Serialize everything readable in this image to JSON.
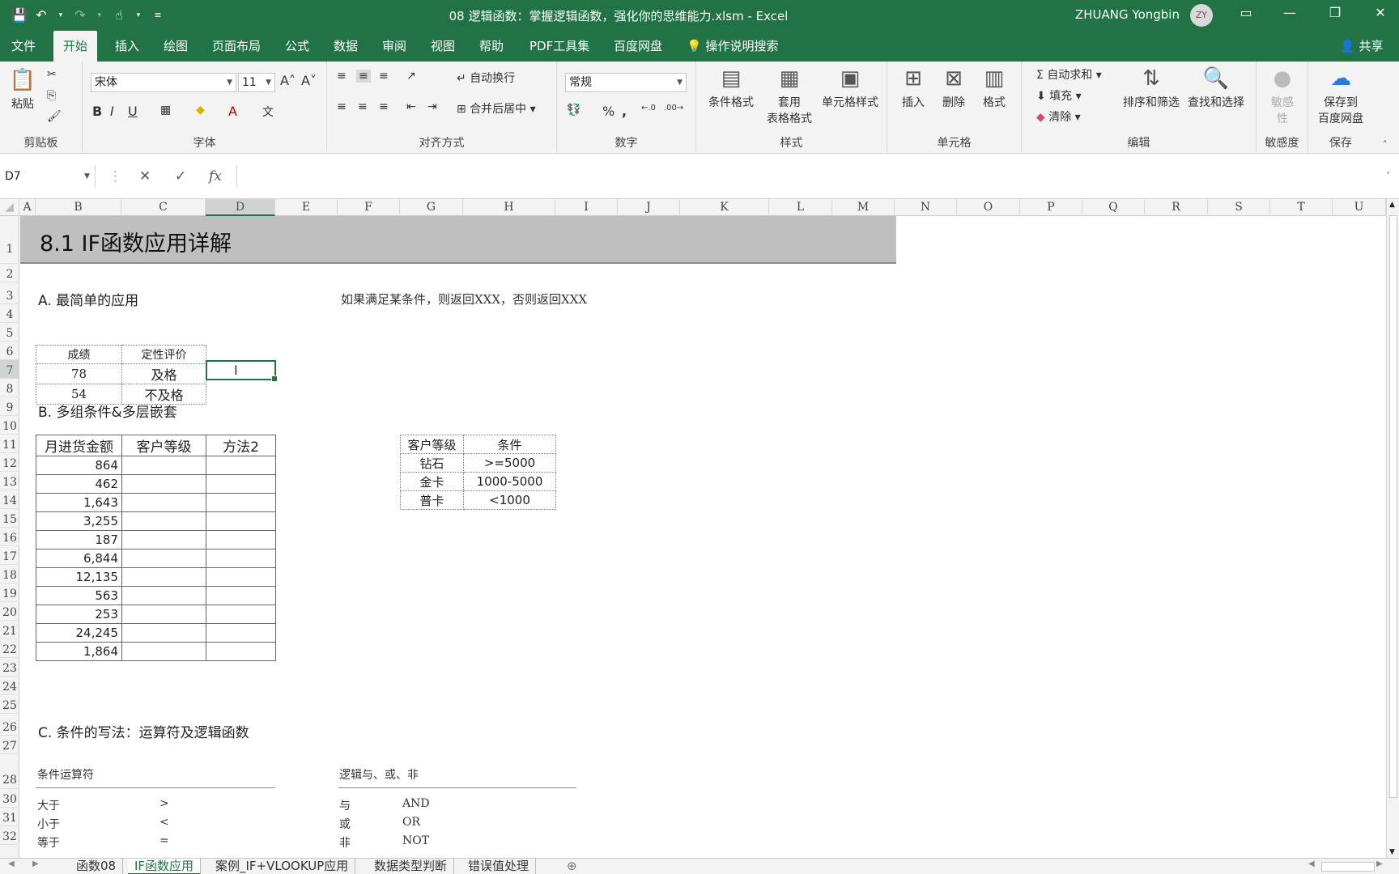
{
  "titlebar": {
    "title": "08 逻辑函数：掌握逻辑函数，强化你的思维能力.xlsm - Excel",
    "user": "ZHUANG Yongbin",
    "avatar": "ZY"
  },
  "tabs": [
    "文件",
    "开始",
    "插入",
    "绘图",
    "页面布局",
    "公式",
    "数据",
    "审阅",
    "视图",
    "帮助",
    "PDF工具集",
    "百度网盘"
  ],
  "tell_me": "操作说明搜索",
  "share": "共享",
  "ribbon": {
    "clipboard": {
      "paste": "粘贴",
      "label": "剪贴板"
    },
    "font": {
      "name": "宋体",
      "size": "11",
      "bold": "B",
      "italic": "I",
      "underline": "U",
      "label": "字体"
    },
    "align": {
      "wrap": "自动换行",
      "merge": "合并后居中",
      "label": "对齐方式"
    },
    "number": {
      "format": "常规",
      "pct": "%",
      "comma": ",",
      "label": "数字"
    },
    "styles": {
      "cond": "条件格式",
      "table1": "套用",
      "table2": "表格格式",
      "cell": "单元格样式",
      "label": "样式"
    },
    "cells": {
      "insert": "插入",
      "delete": "删除",
      "format": "格式",
      "label": "单元格"
    },
    "edit": {
      "autosum": "自动求和",
      "fill": "填充",
      "clear": "清除",
      "sort": "排序和筛选",
      "find": "查找和选择",
      "label": "编辑"
    },
    "sens": {
      "btn1": "敏感",
      "btn2": "性",
      "label": "敏感度"
    },
    "save": {
      "btn1": "保存到",
      "btn2": "百度网盘",
      "label": "保存"
    }
  },
  "namebox": "D7",
  "fx": "fx",
  "columns": [
    "A",
    "B",
    "C",
    "D",
    "E",
    "F",
    "G",
    "H",
    "I",
    "J",
    "K",
    "L",
    "M",
    "N",
    "O",
    "P",
    "Q",
    "R",
    "S",
    "T",
    "U"
  ],
  "rows": [
    "1",
    "2",
    "3",
    "4",
    "5",
    "6",
    "7",
    "8",
    "9",
    "10",
    "11",
    "12",
    "13",
    "14",
    "15",
    "16",
    "17",
    "18",
    "19",
    "20",
    "21",
    "22",
    "23",
    "24",
    "25",
    "26",
    "27",
    "28",
    "30",
    "31",
    "32"
  ],
  "sheet": {
    "banner": "8.1 IF函数应用详解",
    "secA": "A. 最简单的应用",
    "noteA": "如果满足某条件，则返回XXX，否则返回XXX",
    "tableA": {
      "headers": [
        "成绩",
        "定性评价"
      ],
      "rows": [
        [
          "78",
          "及格"
        ],
        [
          "54",
          "不及格"
        ]
      ]
    },
    "secB": "B. 多组条件&多层嵌套",
    "tableB": {
      "headers": [
        "月进货金额",
        "客户等级",
        "方法2"
      ],
      "values": [
        "864",
        "462",
        "1,643",
        "3,255",
        "187",
        "6,844",
        "12,135",
        "563",
        "253",
        "24,245",
        "1,864"
      ]
    },
    "tableB2": {
      "headers": [
        "客户等级",
        "条件"
      ],
      "rows": [
        [
          "钻石",
          ">=5000"
        ],
        [
          "金卡",
          "1000-5000"
        ],
        [
          "普卡",
          "<1000"
        ]
      ]
    },
    "secC": "C. 条件的写法：运算符及逻辑函数",
    "subC1": "条件运算符",
    "subC2": "逻辑与、或、非",
    "ops": [
      [
        "大于",
        ">"
      ],
      [
        "小于",
        "<"
      ],
      [
        "等于",
        "="
      ]
    ],
    "logic": [
      [
        "与",
        "AND"
      ],
      [
        "或",
        "OR"
      ],
      [
        "非",
        "NOT"
      ]
    ]
  },
  "sheet_tabs": [
    "函数08",
    "IF函数应用",
    "案例_IF+VLOOKUP应用",
    "数据类型判断",
    "错误值处理"
  ]
}
